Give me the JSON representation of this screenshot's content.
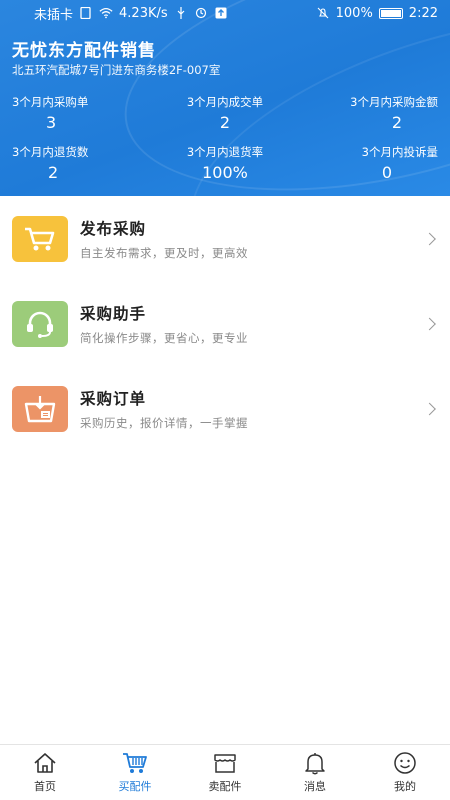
{
  "status_bar": {
    "carrier": "未插卡",
    "speed": "4.23K/s",
    "battery": "100%",
    "time": "2:22"
  },
  "header": {
    "shop_name": "无忧东方配件销售",
    "address": "北五环汽配城7号门进东商务楼2F-007室",
    "stats": [
      {
        "label": "3个月内采购单",
        "value": "3"
      },
      {
        "label": "3个月内成交单",
        "value": "2"
      },
      {
        "label": "3个月内采购金额",
        "value": "2"
      },
      {
        "label": "3个月内退货数",
        "value": "2"
      },
      {
        "label": "3个月内退货率",
        "value": "100%"
      },
      {
        "label": "3个月内投诉量",
        "value": "0"
      }
    ]
  },
  "menu": [
    {
      "title": "发布采购",
      "subtitle": "自主发布需求，更及时，更高效",
      "icon": "cart-icon",
      "color": "#f7c23c"
    },
    {
      "title": "采购助手",
      "subtitle": "简化操作步骤，更省心，更专业",
      "icon": "headset-icon",
      "color": "#9ccc7a"
    },
    {
      "title": "采购订单",
      "subtitle": "采购历史，报价详情，一手掌握",
      "icon": "order-box-icon",
      "color": "#ec9467"
    }
  ],
  "tabbar": {
    "items": [
      {
        "label": "首页",
        "icon": "home-icon"
      },
      {
        "label": "买配件",
        "icon": "cart-icon",
        "active": true
      },
      {
        "label": "卖配件",
        "icon": "store-icon"
      },
      {
        "label": "消息",
        "icon": "bell-icon"
      },
      {
        "label": "我的",
        "icon": "smiley-icon"
      }
    ],
    "active_color": "#1f7bd8"
  }
}
